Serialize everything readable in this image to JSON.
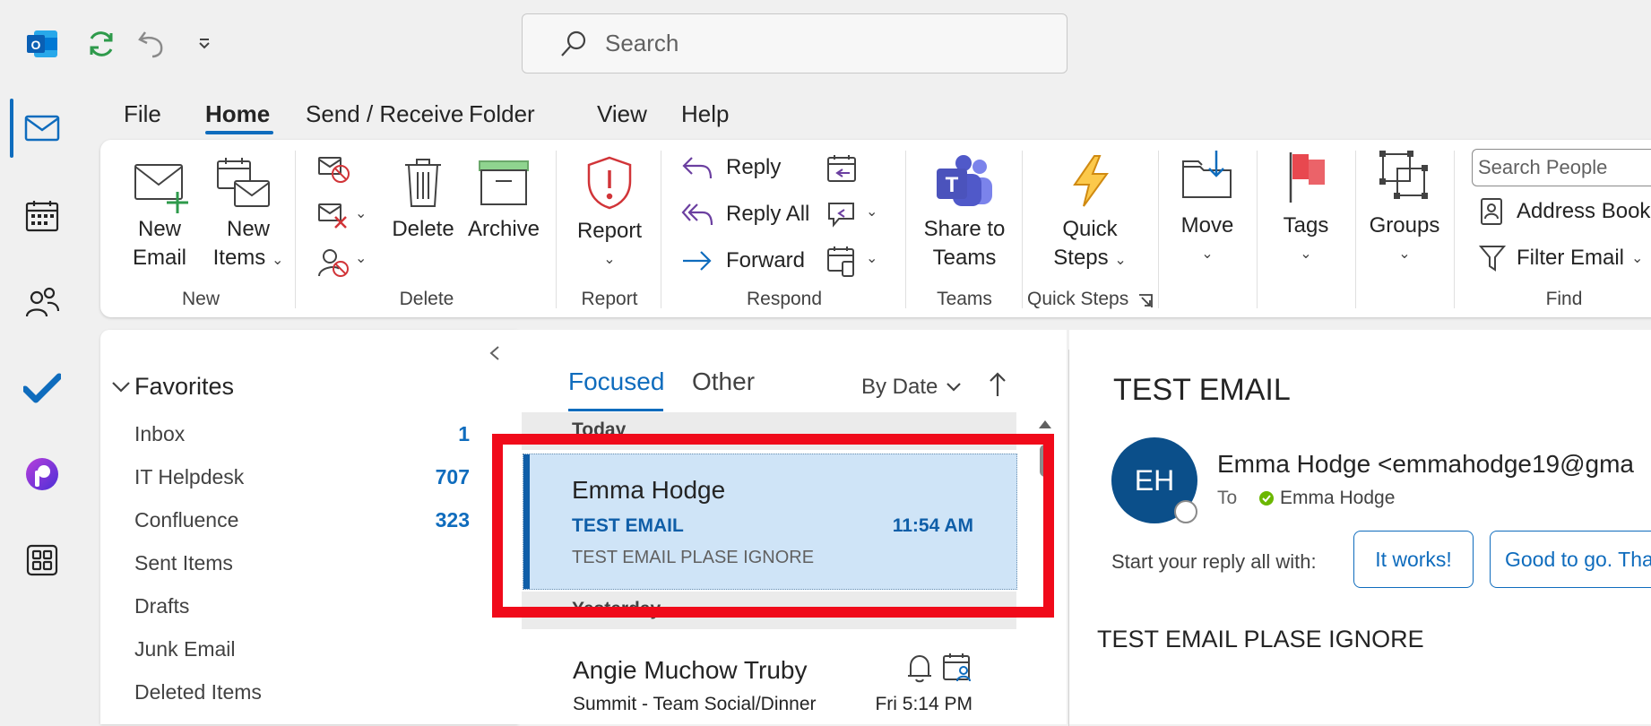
{
  "top": {
    "search_placeholder": "Search"
  },
  "menu": {
    "tabs": [
      "File",
      "Home",
      "Send / Receive",
      "Folder",
      "View",
      "Help"
    ]
  },
  "ribbon": {
    "new": {
      "new_email": [
        "New",
        "Email"
      ],
      "new_items": [
        "New",
        "Items"
      ],
      "group": "New"
    },
    "delete": {
      "delete": "Delete",
      "archive": "Archive",
      "group": "Delete"
    },
    "report": {
      "label": "Report",
      "group": "Report"
    },
    "respond": {
      "reply": "Reply",
      "reply_all": "Reply All",
      "forward": "Forward",
      "group": "Respond"
    },
    "teams": {
      "label": [
        "Share to",
        "Teams"
      ],
      "group": "Teams"
    },
    "quick_steps": {
      "label": [
        "Quick",
        "Steps"
      ],
      "group": "Quick Steps"
    },
    "move": {
      "label": "Move"
    },
    "tags": {
      "label": "Tags"
    },
    "groups": {
      "label": "Groups"
    },
    "find": {
      "search_people": "Search People",
      "address_book": "Address Book",
      "filter_email": "Filter Email",
      "group": "Find"
    }
  },
  "folders": {
    "favorites_label": "Favorites",
    "items": [
      {
        "name": "Inbox",
        "count": "1"
      },
      {
        "name": "IT Helpdesk",
        "count": "707"
      },
      {
        "name": "Confluence",
        "count": "323"
      },
      {
        "name": "Sent Items",
        "count": ""
      },
      {
        "name": "Drafts",
        "count": ""
      },
      {
        "name": "Junk Email",
        "count": ""
      },
      {
        "name": "Deleted Items",
        "count": ""
      }
    ]
  },
  "message_list": {
    "tab_focused": "Focused",
    "tab_other": "Other",
    "sort_label": "By Date",
    "group_today": "Today",
    "group_yesterday": "Yesterday",
    "messages": [
      {
        "sender": "Emma Hodge",
        "subject": "TEST EMAIL",
        "time": "11:54 AM",
        "preview": "TEST EMAIL PLASE IGNORE"
      },
      {
        "sender": "Angie Muchow Truby",
        "subject": "Summit - Team Social/Dinner",
        "time": "Fri 5:14 PM",
        "preview": ""
      }
    ]
  },
  "reading_pane": {
    "subject": "TEST EMAIL",
    "avatar_initials": "EH",
    "from": "Emma Hodge <emmahodge19@gma",
    "to_label": "To",
    "to_name": "Emma Hodge",
    "reply_prompt": "Start your reply all with:",
    "suggestions": [
      "It works!",
      "Good to go. Tha"
    ],
    "body": "TEST EMAIL PLASE IGNORE"
  },
  "colors": {
    "accent": "#0f6cbd",
    "selected_bg": "#cfe4f7",
    "highlight": "#f00a1a",
    "avatar_bg": "#0b4f8a"
  }
}
